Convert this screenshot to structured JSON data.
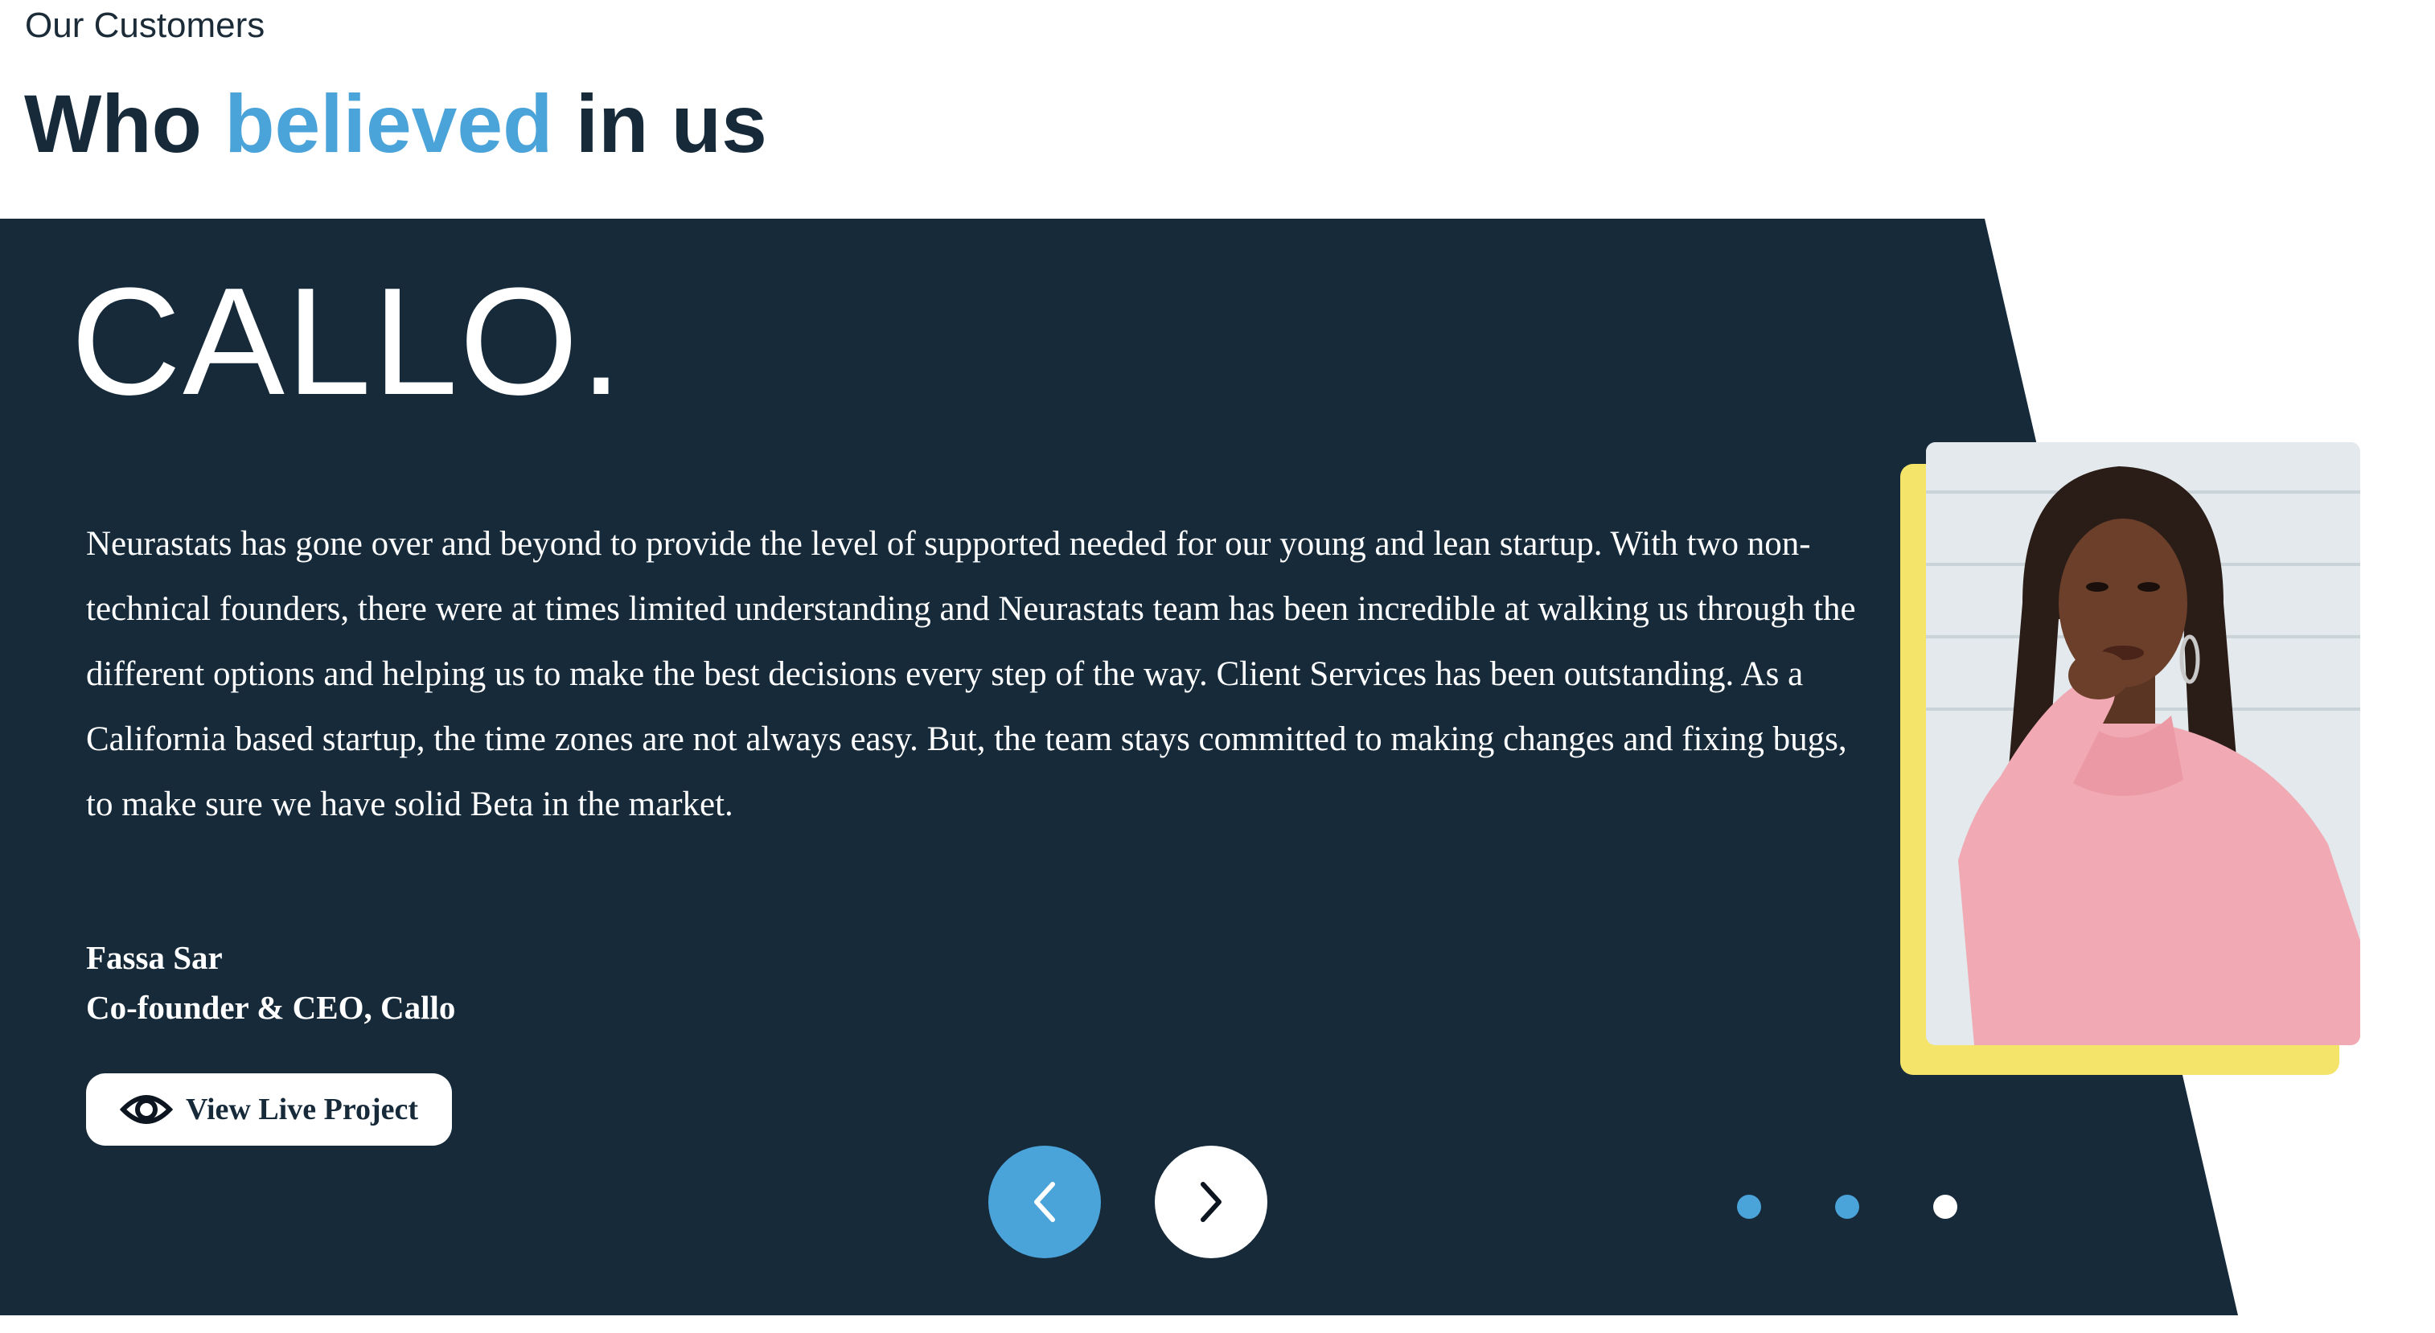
{
  "section": {
    "eyebrow": "Our Customers",
    "headline": {
      "before": "Who ",
      "accent": "believed",
      "after": " in us"
    }
  },
  "testimonial": {
    "brand_logo": "CALLO.",
    "quote": "Neurastats has gone over and beyond to provide the level of supported needed for our young and lean startup. With two non-technical founders, there were at times limited understanding and Neurastats team has been incredible at walking us through the different options and helping us to make the best decisions every step of the way. Client Services has been outstanding. As a California based startup, the time zones are not always easy. But, the team stays committed to making changes and fixing bugs, to make sure we have solid Beta in the market.",
    "author_name": "Fassa Sar",
    "author_title": "Co-founder & CEO, Callo",
    "button_label": "View Live Project",
    "button_icon": "eye-icon",
    "photo_icon": "customer-portrait"
  },
  "carousel": {
    "prev_icon": "chevron-left-icon",
    "next_icon": "chevron-right-icon",
    "dots": 3,
    "active_dot": 3
  },
  "colors": {
    "panel": "#162a3a",
    "accent": "#4aa3d9",
    "frame": "#f4e46a",
    "white": "#ffffff"
  }
}
